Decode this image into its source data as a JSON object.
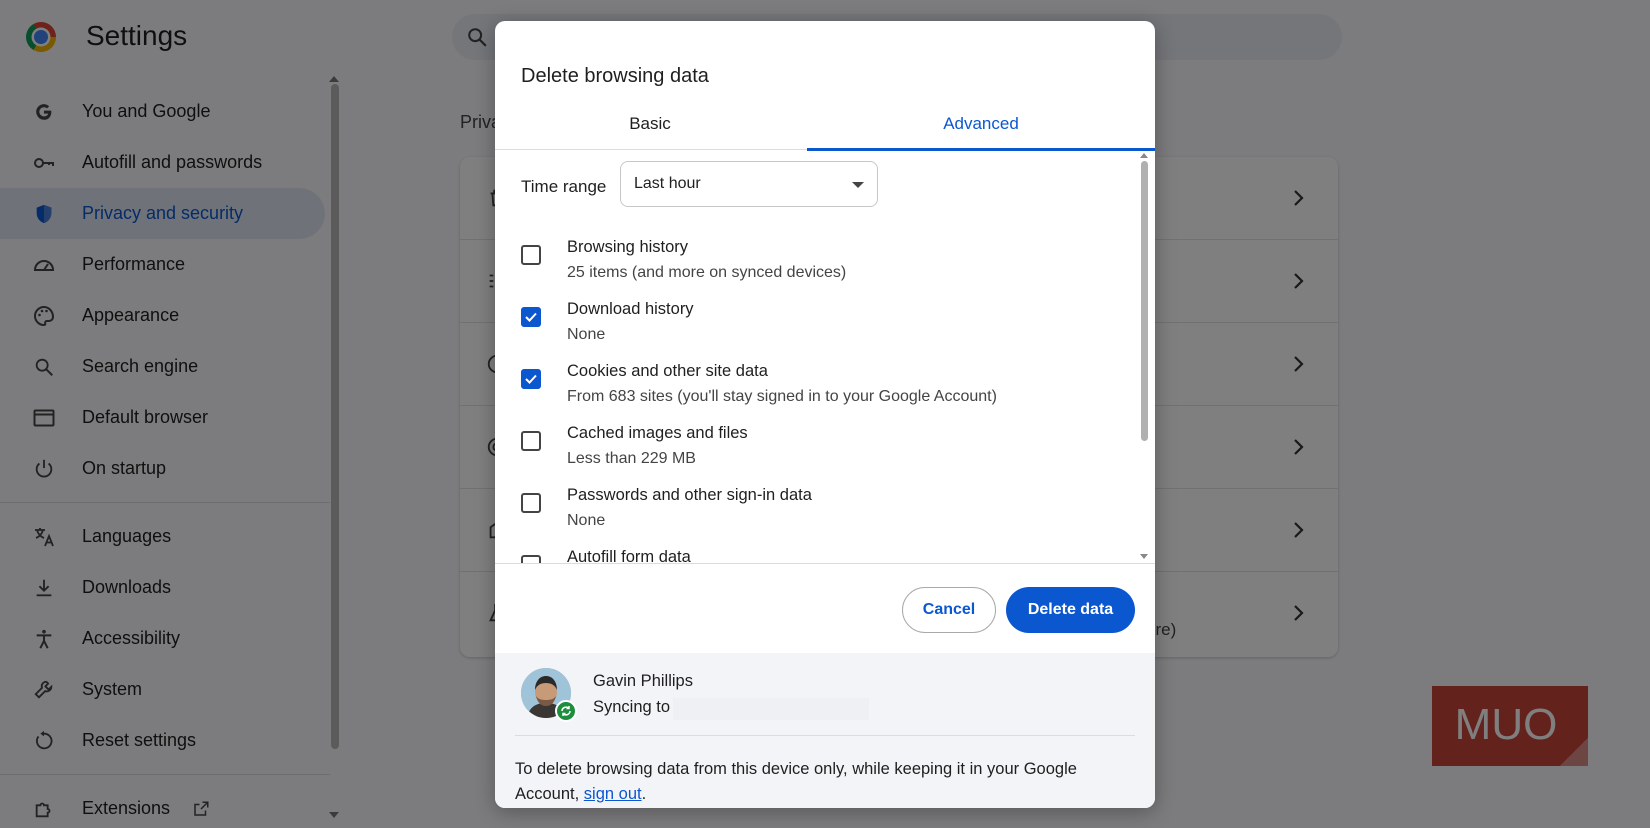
{
  "app": {
    "title": "Settings"
  },
  "colors": {
    "accent": "#0b57d0",
    "sync_badge": "#1e8e3e",
    "watermark": "#c8453b"
  },
  "sidebar": {
    "items": [
      {
        "label": "You and Google",
        "icon": "google-g-icon",
        "active": false
      },
      {
        "label": "Autofill and passwords",
        "icon": "key-icon",
        "active": false
      },
      {
        "label": "Privacy and security",
        "icon": "shield-icon",
        "active": true
      },
      {
        "label": "Performance",
        "icon": "speedometer-icon",
        "active": false
      },
      {
        "label": "Appearance",
        "icon": "palette-icon",
        "active": false
      },
      {
        "label": "Search engine",
        "icon": "search-icon",
        "active": false
      },
      {
        "label": "Default browser",
        "icon": "browser-window-icon",
        "active": false
      },
      {
        "label": "On startup",
        "icon": "power-icon",
        "active": false
      }
    ],
    "items2": [
      {
        "label": "Languages",
        "icon": "translate-icon"
      },
      {
        "label": "Downloads",
        "icon": "download-icon"
      },
      {
        "label": "Accessibility",
        "icon": "accessibility-icon"
      },
      {
        "label": "System",
        "icon": "wrench-icon"
      },
      {
        "label": "Reset settings",
        "icon": "reset-icon"
      },
      {
        "label": "Extensions",
        "icon": "puzzle-icon"
      }
    ]
  },
  "main": {
    "section_label": "Priva",
    "card_tail": "ore)"
  },
  "watermark": {
    "text": "MUO"
  },
  "dialog": {
    "title": "Delete browsing data",
    "tabs": [
      {
        "label": "Basic",
        "selected": false
      },
      {
        "label": "Advanced",
        "selected": true
      }
    ],
    "time_range": {
      "label": "Time range",
      "value": "Last hour"
    },
    "options": [
      {
        "label": "Browsing history",
        "sub": "25 items (and more on synced devices)",
        "checked": false
      },
      {
        "label": "Download history",
        "sub": "None",
        "checked": true
      },
      {
        "label": "Cookies and other site data",
        "sub": "From 683 sites (you'll stay signed in to your Google Account)",
        "checked": true
      },
      {
        "label": "Cached images and files",
        "sub": "Less than 229 MB",
        "checked": false
      },
      {
        "label": "Passwords and other sign-in data",
        "sub": "None",
        "checked": false
      },
      {
        "label": "Autofill form data",
        "sub": "",
        "checked": false
      }
    ],
    "buttons": {
      "cancel": "Cancel",
      "delete": "Delete data"
    },
    "account": {
      "name": "Gavin Phillips",
      "sync_prefix": "Syncing to",
      "note_text": "To delete browsing data from this device only, while keeping it in your Google Account, ",
      "note_link": "sign out",
      "note_end": "."
    }
  }
}
